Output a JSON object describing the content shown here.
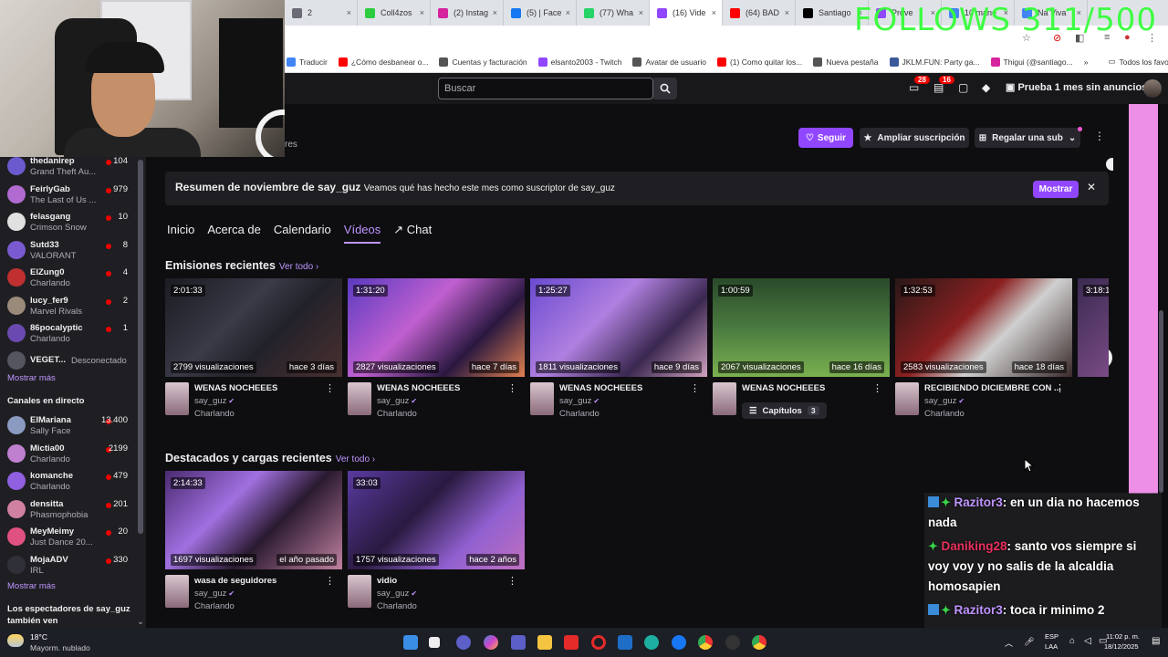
{
  "browser": {
    "tabs": [
      {
        "label": "2",
        "color": "#6b6b75"
      },
      {
        "label": "Coll4zos",
        "color": "#2ecc40"
      },
      {
        "label": "(2) Instag",
        "color": "#d6249f"
      },
      {
        "label": "(5) | Face",
        "color": "#1877f2"
      },
      {
        "label": "(77) Wha",
        "color": "#25d366"
      },
      {
        "label": "(16) Vide",
        "color": "#9147ff",
        "active": true
      },
      {
        "label": "(64) BAD",
        "color": "#ff0000"
      },
      {
        "label": "Santiago",
        "color": "#000000"
      },
      {
        "label": "Prove",
        "color": "#9147ff"
      },
      {
        "label": "10 mane",
        "color": "#4285f4"
      },
      {
        "label": "Na Viva",
        "color": "#4285f4"
      }
    ],
    "bookmarks": [
      {
        "label": "Traducir",
        "color": "#4285f4"
      },
      {
        "label": "¿Cómo desbanear o...",
        "color": "#ff0000"
      },
      {
        "label": "Cuentas y facturación",
        "color": "#555555"
      },
      {
        "label": "elsanto2003 - Twitch",
        "color": "#9147ff"
      },
      {
        "label": "Avatar de usuario",
        "color": "#555555"
      },
      {
        "label": "(1) Como quitar los...",
        "color": "#ff0000"
      },
      {
        "label": "Nueva pestaña",
        "color": "#555555"
      },
      {
        "label": "JKLM.FUN: Party ga...",
        "color": "#3b5998"
      },
      {
        "label": "Thigui (@santiago...",
        "color": "#d6249f"
      }
    ],
    "bookmarks_all": "Todos los favoritos"
  },
  "overlay": {
    "follows": "FOLLOWS 311/500"
  },
  "topnav": {
    "search_placeholder": "Buscar",
    "inbox_count": "28",
    "notif_count": "16",
    "prime_label": "Prueba 1 mes sin anuncios"
  },
  "channel_header": {
    "partial_text": "res",
    "follow_label": "Seguir",
    "upgrade_label": "Ampliar suscripción",
    "gift_label": "Regalar una sub"
  },
  "recap": {
    "title": "Resumen de noviembre de say_guz",
    "subtitle": "Veamos qué has hecho este mes como suscriptor de say_guz",
    "show_label": "Mostrar"
  },
  "tabs": [
    "Inicio",
    "Acerca de",
    "Calendario",
    "Vídeos",
    "Chat"
  ],
  "recent": {
    "title": "Emisiones recientes",
    "see_all": "Ver todo ›",
    "videos": [
      {
        "duration": "2:01:33",
        "views": "2799 visualizaciones",
        "ago": "hace 3 días",
        "title": "WENAS NOCHEEES",
        "channel": "say_guz",
        "game": "Charlando"
      },
      {
        "duration": "1:31:20",
        "views": "2827 visualizaciones",
        "ago": "hace 7 días",
        "title": "WENAS NOCHEEES",
        "channel": "say_guz",
        "game": "Charlando"
      },
      {
        "duration": "1:25:27",
        "views": "1811 visualizaciones",
        "ago": "hace 9 días",
        "title": "WENAS NOCHEEES",
        "channel": "say_guz",
        "game": "Charlando"
      },
      {
        "duration": "1:00:59",
        "views": "2067 visualizaciones",
        "ago": "hace 16 días",
        "title": "WENAS NOCHEEES",
        "chapters_label": "Capítulos",
        "chapters_count": "3"
      },
      {
        "duration": "1:32:53",
        "views": "2583 visualizaciones",
        "ago": "hace 18 días",
        "title": "RECIBIENDO DICIEMBRE CON ...",
        "channel": "say_guz",
        "game": "Charlando"
      },
      {
        "duration": "3:18:1"
      }
    ]
  },
  "highlights": {
    "title": "Destacados y cargas recientes",
    "see_all": "Ver todo ›",
    "videos": [
      {
        "duration": "2:14:33",
        "views": "1697 visualizaciones",
        "ago": "el año pasado",
        "title": "wasa de seguidores",
        "channel": "say_guz",
        "game": "Charlando"
      },
      {
        "duration": "33:03",
        "views": "1757 visualizaciones",
        "ago": "hace 2 años",
        "title": "vidio",
        "channel": "say_guz",
        "game": "Charlando"
      }
    ]
  },
  "sidebar": {
    "followed": [
      {
        "name": "thedanirep",
        "game": "Grand Theft Au...",
        "viewers": "104",
        "color": "#6a5acd"
      },
      {
        "name": "FeirlyGab",
        "game": "The Last of Us ...",
        "viewers": "979",
        "color": "#b06ad0"
      },
      {
        "name": "felasgang",
        "game": "Crimson Snow",
        "viewers": "10",
        "color": "#e0e0e0"
      },
      {
        "name": "Sutd33",
        "game": "VALORANT",
        "viewers": "8",
        "color": "#7a5ad0"
      },
      {
        "name": "ElZung0",
        "game": "Charlando",
        "viewers": "4",
        "color": "#c03030"
      },
      {
        "name": "lucy_fer9",
        "game": "Marvel Rivals",
        "viewers": "2",
        "color": "#9a8a7a"
      },
      {
        "name": "86pocalyptic",
        "game": "Charlando",
        "viewers": "1",
        "color": "#6a4ab0"
      }
    ],
    "offline": {
      "name": "VEGET...",
      "status": "Desconectado"
    },
    "show_more_1": "Mostrar más",
    "live_header": "Canales en directo",
    "live": [
      {
        "name": "ElMariana",
        "game": "Sally Face",
        "viewers": "13.400",
        "color": "#8a9ac0"
      },
      {
        "name": "Mictia00",
        "game": "Charlando",
        "viewers": "2199",
        "color": "#c080d0"
      },
      {
        "name": "komanche",
        "game": "Charlando",
        "viewers": "479",
        "color": "#9060e0"
      },
      {
        "name": "densitta",
        "game": "Phasmophobia",
        "viewers": "201",
        "color": "#d080a0"
      },
      {
        "name": "MeyMeimy",
        "game": "Just Dance 20...",
        "viewers": "20",
        "color": "#e05080"
      },
      {
        "name": "MojaADV",
        "game": "IRL",
        "viewers": "330",
        "color": "#303038"
      }
    ],
    "show_more_2": "Mostrar más",
    "also_watch": "Los espectadores de say_guz también ven"
  },
  "chat": [
    {
      "user": "Razitor3",
      "text": ": en un dia no hacemos nada",
      "cls": "u1",
      "blue": true
    },
    {
      "user": "Daniking28",
      "text": ": santo vos siempre si voy voy y no salis de la alcaldia homosapien",
      "cls": "u2",
      "blue": false
    },
    {
      "user": "Razitor3",
      "text": ": toca ir minimo 2",
      "cls": "u1",
      "blue": true
    }
  ],
  "taskbar": {
    "temp": "18°C",
    "weather": "Mayorm. nublado",
    "lang1": "ESP",
    "lang2": "LAA",
    "time": "11:02 p. m.",
    "date": "18/12/2025"
  }
}
